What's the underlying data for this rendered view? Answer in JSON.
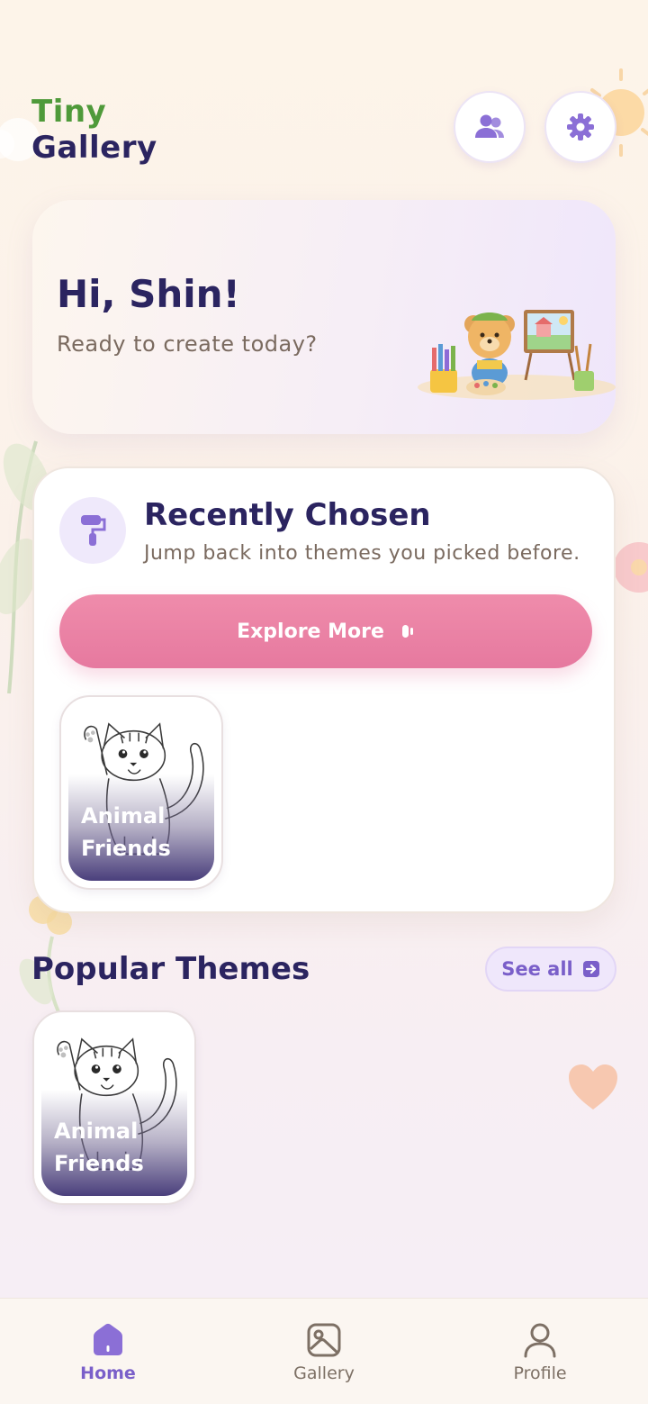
{
  "app": {
    "title_line1": "Tiny",
    "title_line2": "Gallery"
  },
  "header": {
    "users_icon": "users-icon",
    "settings_icon": "gear-icon"
  },
  "hero": {
    "greeting": "Hi, Shin!",
    "subtitle": "Ready to create today?"
  },
  "recent": {
    "title": "Recently Chosen",
    "subtitle": "Jump back into themes you picked before.",
    "explore_label": "Explore More",
    "items": [
      {
        "label": "Animal Friends"
      }
    ]
  },
  "popular": {
    "title": "Popular Themes",
    "see_all_label": "See all",
    "items": [
      {
        "label": "Animal Friends"
      }
    ]
  },
  "nav": {
    "items": [
      {
        "label": "Home",
        "icon": "home-icon",
        "active": true
      },
      {
        "label": "Gallery",
        "icon": "gallery-icon",
        "active": false
      },
      {
        "label": "Profile",
        "icon": "profile-icon",
        "active": false
      }
    ]
  },
  "colors": {
    "accent": "#7a5fc9",
    "primary_text": "#2b2460",
    "explore_button": "#e97fa4",
    "tiny_green": "#4f9a3a"
  }
}
